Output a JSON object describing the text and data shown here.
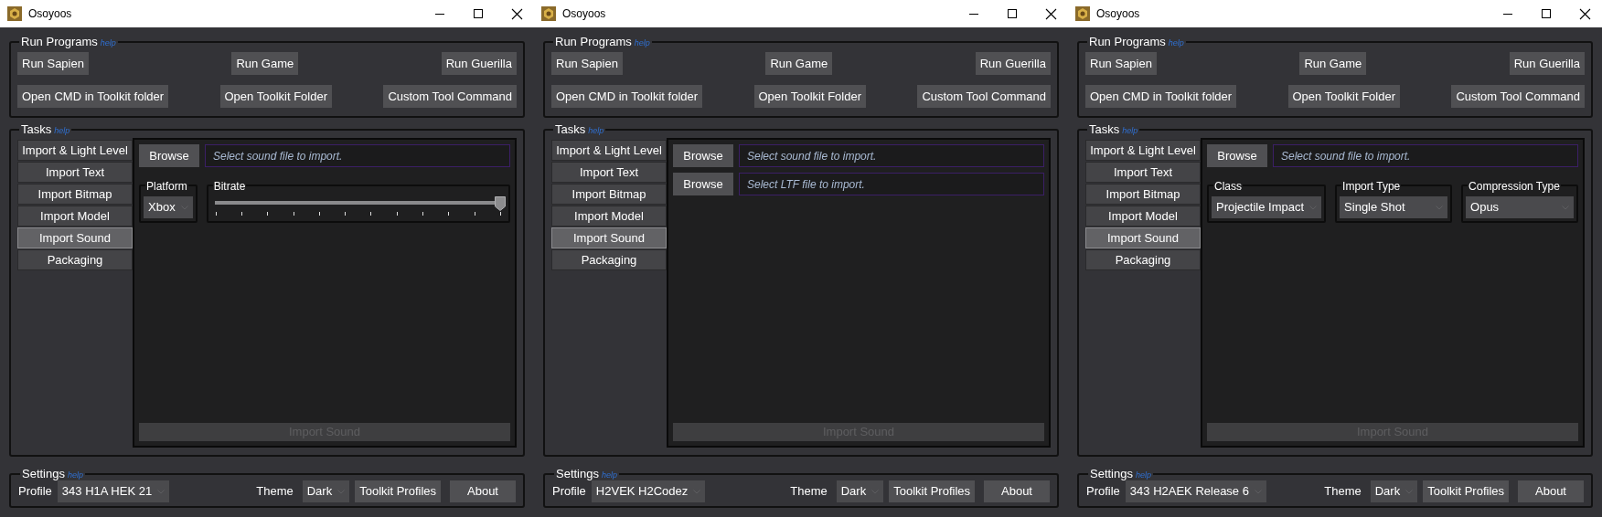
{
  "windows": [
    {
      "title": "Osoyoos",
      "run_programs": {
        "title": "Run Programs",
        "help": "help",
        "rows": [
          [
            "Run Sapien",
            "Run Game",
            "Run Guerilla"
          ],
          [
            "Open CMD in Toolkit folder",
            "Open Toolkit Folder",
            "Custom Tool Command"
          ]
        ]
      },
      "tasks": {
        "title": "Tasks",
        "help": "help",
        "items": [
          {
            "label": "Import & Light Level",
            "selected": false
          },
          {
            "label": "Import Text",
            "selected": false
          },
          {
            "label": "Import Bitmap",
            "selected": false
          },
          {
            "label": "Import Model",
            "selected": false
          },
          {
            "label": "Import Sound",
            "selected": true
          },
          {
            "label": "Packaging",
            "selected": false
          }
        ],
        "file_inputs": [
          {
            "button": "Browse",
            "placeholder": "Select sound file to import."
          }
        ],
        "options": [
          {
            "kind": "combo",
            "label": "Platform",
            "value": "Xbox"
          },
          {
            "kind": "slider",
            "label": "Bitrate",
            "level": 1
          }
        ],
        "action": {
          "label": "Import Sound",
          "disabled": true
        }
      },
      "settings": {
        "title": "Settings",
        "help": "help",
        "profile_label": "Profile",
        "profile": "343 H1A HEK 21",
        "theme_label": "Theme",
        "theme": "Dark",
        "buttons": [
          "Toolkit Profiles",
          "About"
        ]
      }
    },
    {
      "title": "Osoyoos",
      "run_programs": {
        "title": "Run Programs",
        "help": "help",
        "rows": [
          [
            "Run Sapien",
            "Run Game",
            "Run Guerilla"
          ],
          [
            "Open CMD in Toolkit folder",
            "Open Toolkit Folder",
            "Custom Tool Command"
          ]
        ]
      },
      "tasks": {
        "title": "Tasks",
        "help": "help",
        "items": [
          {
            "label": "Import & Light Level",
            "selected": false
          },
          {
            "label": "Import Text",
            "selected": false
          },
          {
            "label": "Import Bitmap",
            "selected": false
          },
          {
            "label": "Import Model",
            "selected": false
          },
          {
            "label": "Import Sound",
            "selected": true
          },
          {
            "label": "Packaging",
            "selected": false
          }
        ],
        "file_inputs": [
          {
            "button": "Browse",
            "placeholder": "Select sound file to import."
          },
          {
            "button": "Browse",
            "placeholder": "Select LTF file to import."
          }
        ],
        "action": {
          "label": "Import Sound",
          "disabled": true
        }
      },
      "settings": {
        "title": "Settings",
        "help": "help",
        "profile_label": "Profile",
        "profile": "H2VEK H2Codez",
        "theme_label": "Theme",
        "theme": "Dark",
        "buttons": [
          "Toolkit Profiles",
          "About"
        ]
      }
    },
    {
      "title": "Osoyoos",
      "run_programs": {
        "title": "Run Programs",
        "help": "help",
        "rows": [
          [
            "Run Sapien",
            "Run Game",
            "Run Guerilla"
          ],
          [
            "Open CMD in Toolkit folder",
            "Open Toolkit Folder",
            "Custom Tool Command"
          ]
        ]
      },
      "tasks": {
        "title": "Tasks",
        "help": "help",
        "items": [
          {
            "label": "Import & Light Level",
            "selected": false
          },
          {
            "label": "Import Text",
            "selected": false
          },
          {
            "label": "Import Bitmap",
            "selected": false
          },
          {
            "label": "Import Model",
            "selected": false
          },
          {
            "label": "Import Sound",
            "selected": true
          },
          {
            "label": "Packaging",
            "selected": false
          }
        ],
        "file_inputs": [
          {
            "button": "Browse",
            "placeholder": "Select sound file to import."
          }
        ],
        "options": [
          {
            "kind": "combo",
            "label": "Class",
            "value": "Projectile Impact"
          },
          {
            "kind": "combo",
            "label": "Import Type",
            "value": "Single Shot"
          },
          {
            "kind": "combo",
            "label": "Compression Type",
            "value": "Opus"
          }
        ],
        "action": {
          "label": "Import Sound",
          "disabled": true
        }
      },
      "settings": {
        "title": "Settings",
        "help": "help",
        "profile_label": "Profile",
        "profile": "343 H2AEK Release 6",
        "theme_label": "Theme",
        "theme": "Dark",
        "buttons": [
          "Toolkit Profiles",
          "About"
        ]
      }
    }
  ]
}
